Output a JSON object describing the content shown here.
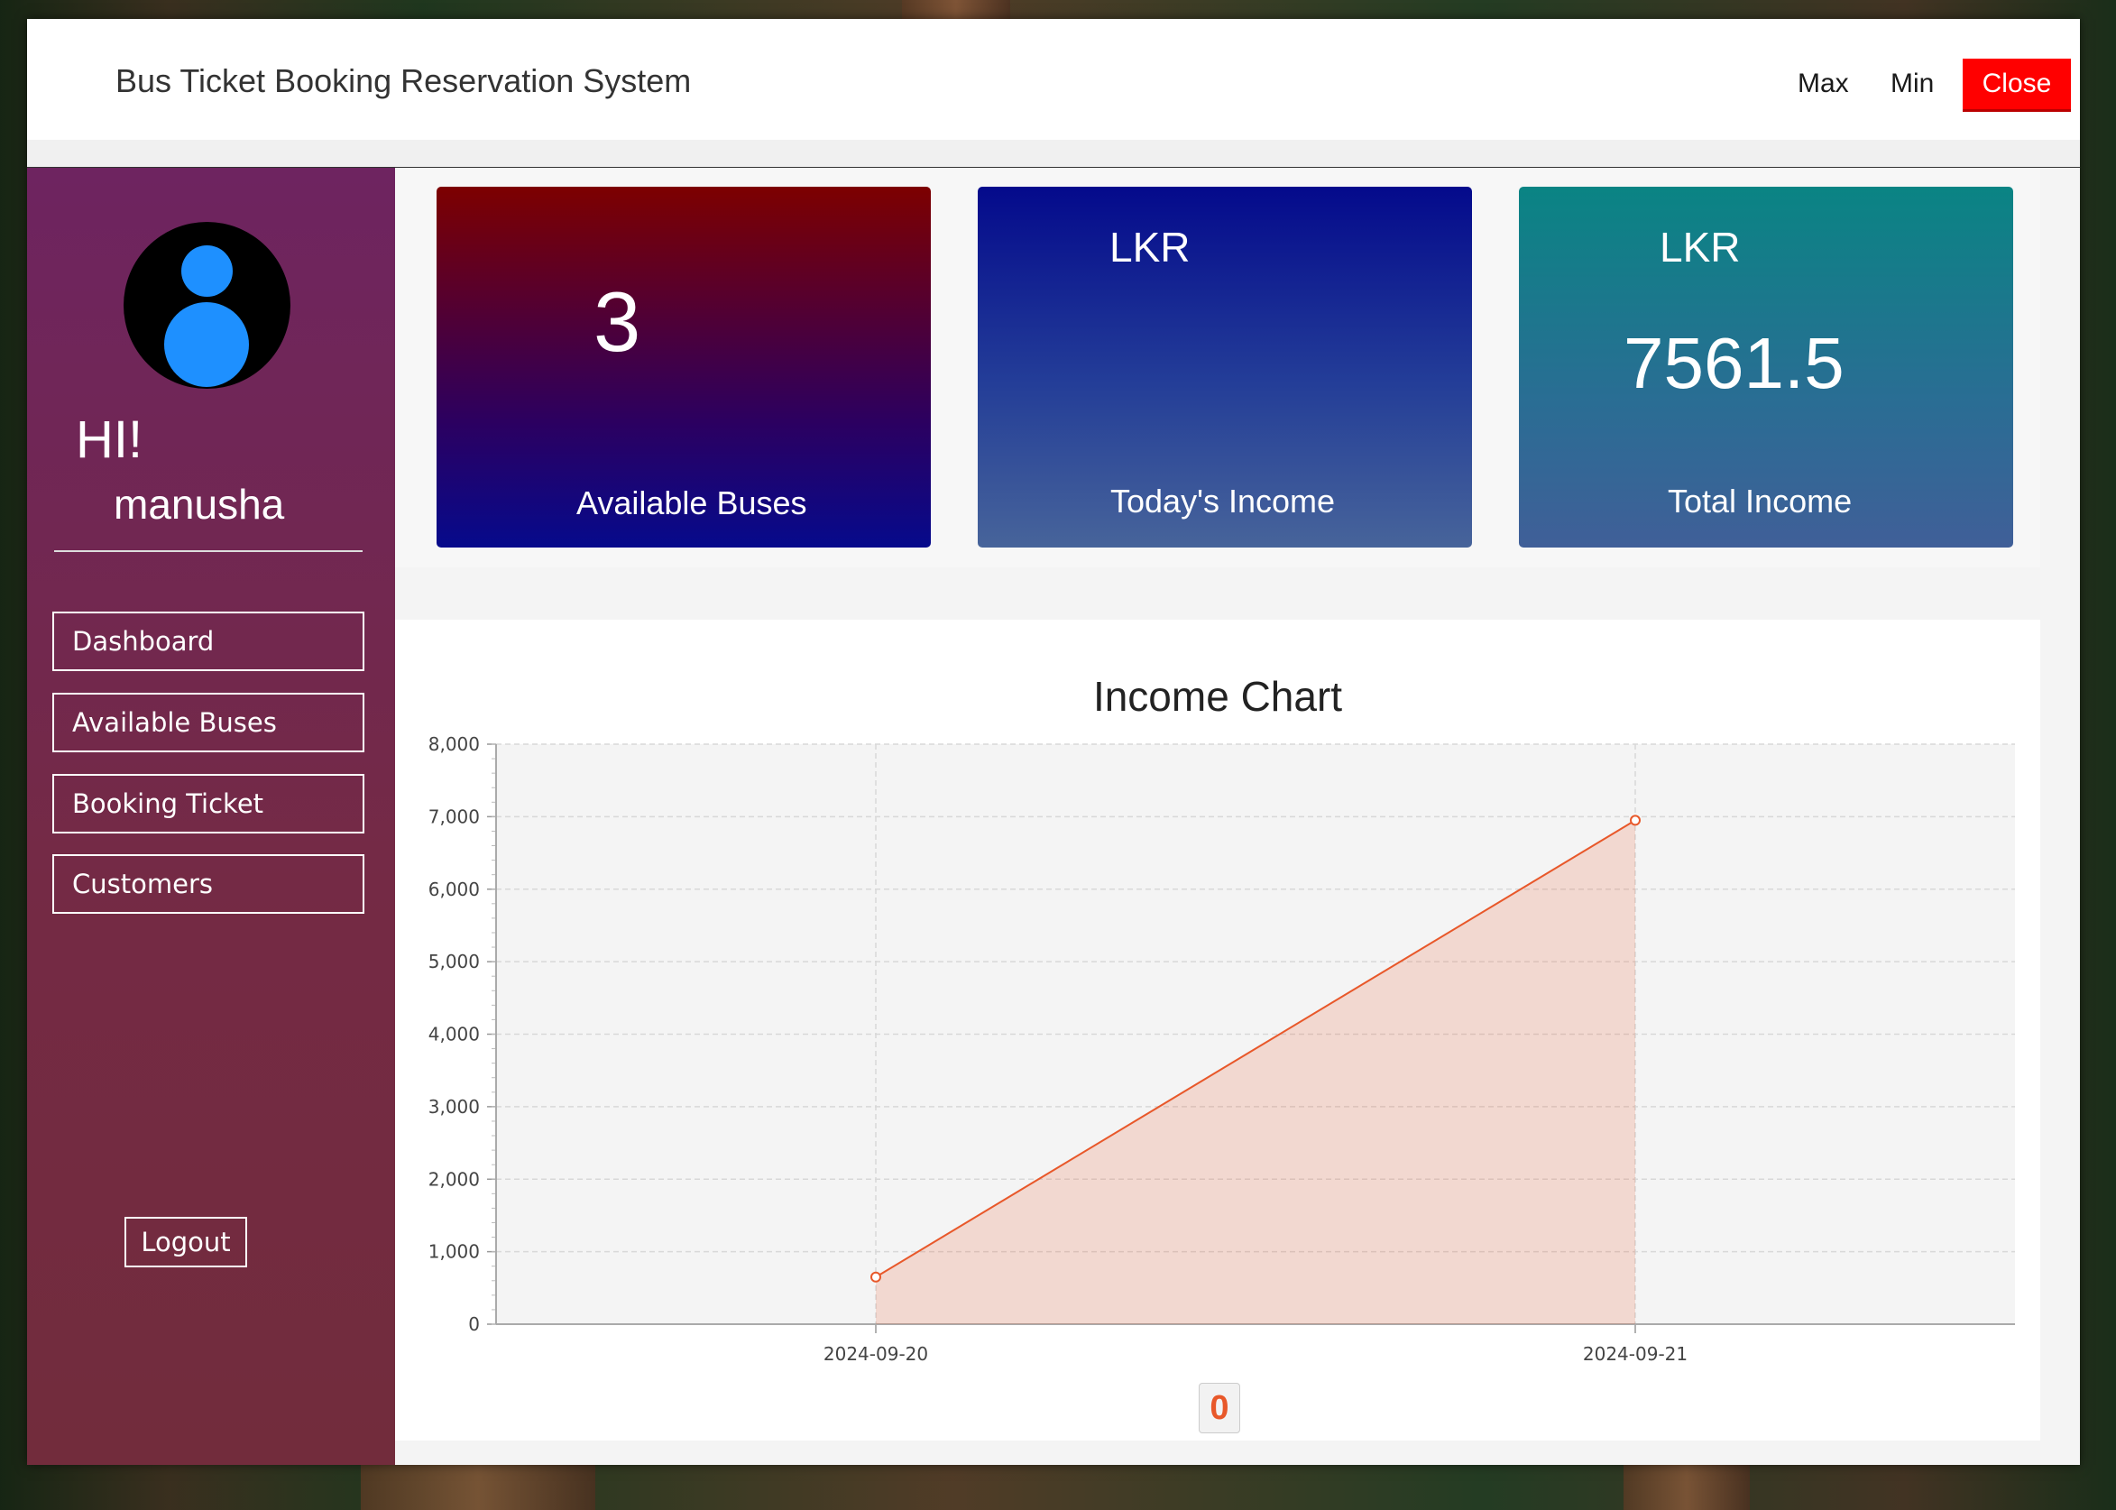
{
  "window": {
    "title": "Bus Ticket Booking Reservation System",
    "max_label": "Max",
    "min_label": "Min",
    "close_label": "Close",
    "close_color": "#ff0000"
  },
  "sidebar": {
    "greeting": "HI!",
    "username": "manusha",
    "avatar_icon": "user-avatar-icon",
    "items": [
      {
        "label": "Dashboard"
      },
      {
        "label": "Available Buses"
      },
      {
        "label": "Booking Ticket"
      },
      {
        "label": "Customers"
      }
    ],
    "logout_label": "Logout"
  },
  "cards": {
    "available_buses": {
      "value": "3",
      "label": "Available Buses"
    },
    "todays_income": {
      "currency": "LKR",
      "value": "",
      "label": "Today's Income"
    },
    "total_income": {
      "currency": "LKR",
      "value": "7561.5",
      "label": "Total Income"
    }
  },
  "chart_data": {
    "type": "area",
    "title": "Income Chart",
    "x": [
      "2024-09-20",
      "2024-09-21"
    ],
    "series": [
      {
        "name": "0",
        "values": [
          650,
          6950
        ],
        "color": "#e8582a"
      }
    ],
    "ylim": [
      0,
      8000
    ],
    "yticks": [
      0,
      1000,
      2000,
      3000,
      4000,
      5000,
      6000,
      7000,
      8000
    ],
    "ytick_labels": [
      "0",
      "1,000",
      "2,000",
      "3,000",
      "4,000",
      "5,000",
      "6,000",
      "7,000",
      "8,000"
    ],
    "grid": true,
    "legend_position": "bottom-center"
  }
}
